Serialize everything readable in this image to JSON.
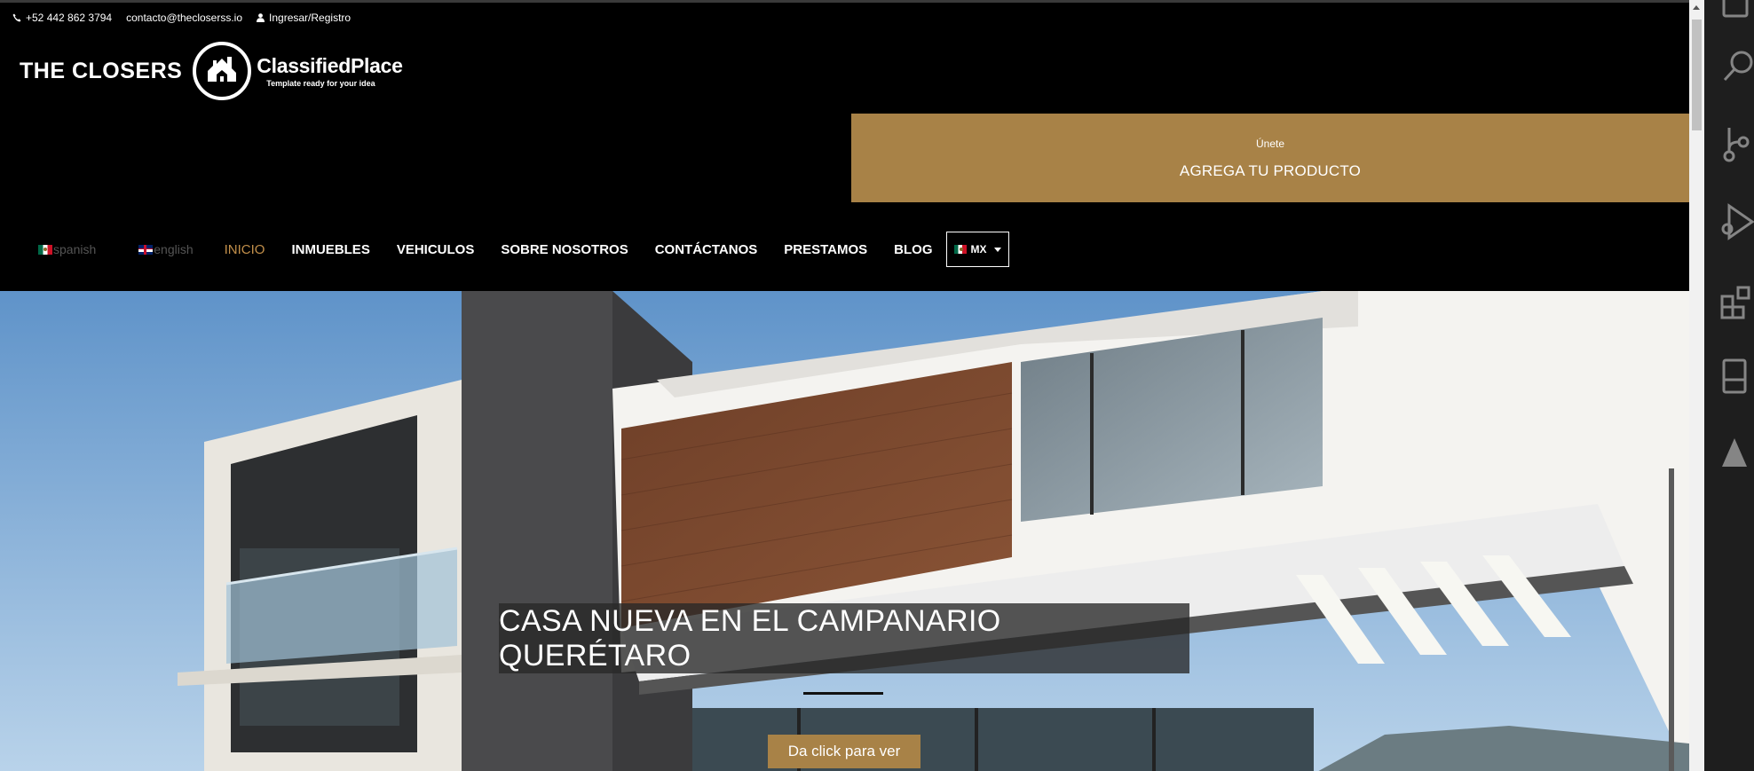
{
  "topbar": {
    "phone": "+52 442 862 3794",
    "email": "contacto@thecloserss.io",
    "login": "Ingresar/Registro"
  },
  "logo": {
    "brand": "THE CLOSERS",
    "product_name": "ClassifiedPlace",
    "tagline": "Template ready for your idea"
  },
  "join_box": {
    "small": "Únete",
    "big": "AGREGA TU PRODUCTO"
  },
  "nav": {
    "languages": [
      {
        "label": "spanish",
        "flag": "mexico-flag-icon"
      },
      {
        "label": "english",
        "flag": "uk-flag-icon"
      }
    ],
    "menu": [
      "INICIO",
      "INMUEBLES",
      "VEHICULOS",
      "SOBRE NOSOTROS",
      "CONTÁCTANOS",
      "PRESTAMOS",
      "BLOG"
    ],
    "active": "INICIO",
    "country": "MX"
  },
  "hero": {
    "caption": "CASA NUEVA EN EL CAMPANARIO QUERÉTARO",
    "cta": "Da click para ver"
  },
  "colors": {
    "accent": "#a88247",
    "active_nav": "#c28f4a",
    "background": "#000000"
  }
}
